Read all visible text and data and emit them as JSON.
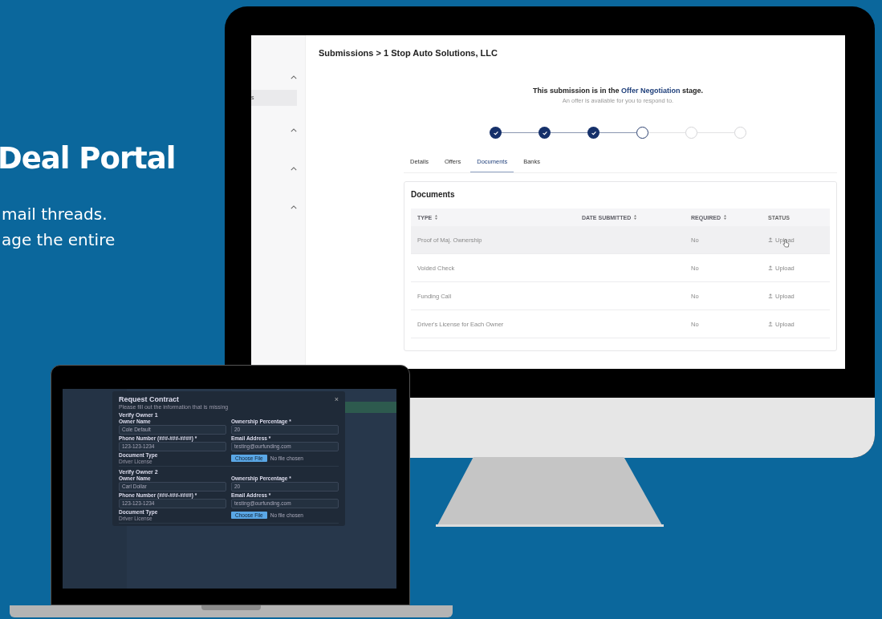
{
  "hero": {
    "title": "Deal Portal",
    "lines": [
      "mail threads.",
      "age the entire"
    ]
  },
  "monitor": {
    "sidebar": {
      "items": [
        {
          "kind": "group",
          "expanded": true
        },
        {
          "kind": "link",
          "label": "s",
          "selected": true
        },
        {
          "kind": "group",
          "expanded": true
        },
        {
          "kind": "group",
          "expanded": true
        },
        {
          "kind": "group",
          "expanded": true
        }
      ]
    },
    "breadcrumb": "Submissions > 1 Stop Auto Solutions, LLC",
    "stage": {
      "before": "This submission is in the",
      "stage_name": "Offer Negotiation",
      "after": "stage.",
      "note": "An offer is available for you to respond to."
    },
    "steps": [
      {
        "completed": true,
        "current": false
      },
      {
        "completed": true,
        "current": false
      },
      {
        "completed": true,
        "current": false
      },
      {
        "completed": false,
        "current": true
      },
      {
        "completed": false,
        "current": false
      },
      {
        "completed": false,
        "current": false
      }
    ],
    "tabs": [
      {
        "label": "Details",
        "selected": false
      },
      {
        "label": "Offers",
        "selected": false
      },
      {
        "label": "Documents",
        "selected": true
      },
      {
        "label": "Banks",
        "selected": false
      }
    ],
    "documents": {
      "title": "Documents",
      "columns": [
        {
          "label": "TYPE",
          "sortable": true
        },
        {
          "label": "DATE SUBMITTED",
          "sortable": true
        },
        {
          "label": "REQUIRED",
          "sortable": true
        },
        {
          "label": "STATUS",
          "sortable": false
        }
      ],
      "rows": [
        {
          "type": "Proof of Maj. Ownership",
          "required": "No",
          "status": "Upload",
          "hovered": true
        },
        {
          "type": "Voided Check",
          "required": "No",
          "status": "Upload",
          "hovered": false
        },
        {
          "type": "Funding Call",
          "required": "No",
          "status": "Upload",
          "hovered": false
        },
        {
          "type": "Driver's License for Each Owner",
          "required": "No",
          "status": "Upload",
          "hovered": false
        }
      ]
    }
  },
  "laptop": {
    "modal": {
      "title": "Request Contract",
      "close": "×",
      "subtitle": "Please fill out the information that is missing",
      "sections": [
        {
          "title": "Verify Owner 1",
          "fields": [
            {
              "kind": "input",
              "label": "Owner Name",
              "value": "Cole Default"
            },
            {
              "kind": "input",
              "label": "Ownership Percentage *",
              "value": "20"
            },
            {
              "kind": "input",
              "label": "Phone Number (###-###-####) *",
              "value": "123-123-1234"
            },
            {
              "kind": "input",
              "label": "Email Address *",
              "value": "testing@ourfunding.com"
            },
            {
              "kind": "text",
              "label": "Document Type",
              "value": "Driver License"
            },
            {
              "kind": "file",
              "button": "Choose File",
              "value": "No file chosen"
            }
          ]
        },
        {
          "title": "Verify Owner 2",
          "fields": [
            {
              "kind": "input",
              "label": "Owner Name",
              "value": "Carl Dollar"
            },
            {
              "kind": "input",
              "label": "Ownership Percentage *",
              "value": "20"
            },
            {
              "kind": "input",
              "label": "Phone Number (###-###-####) *",
              "value": "123-123-1234"
            },
            {
              "kind": "input",
              "label": "Email Address *",
              "value": "testing@ourfunding.com"
            },
            {
              "kind": "text",
              "label": "Document Type",
              "value": "Driver License"
            },
            {
              "kind": "file",
              "button": "Choose File",
              "value": "No file chosen"
            }
          ]
        }
      ]
    }
  }
}
